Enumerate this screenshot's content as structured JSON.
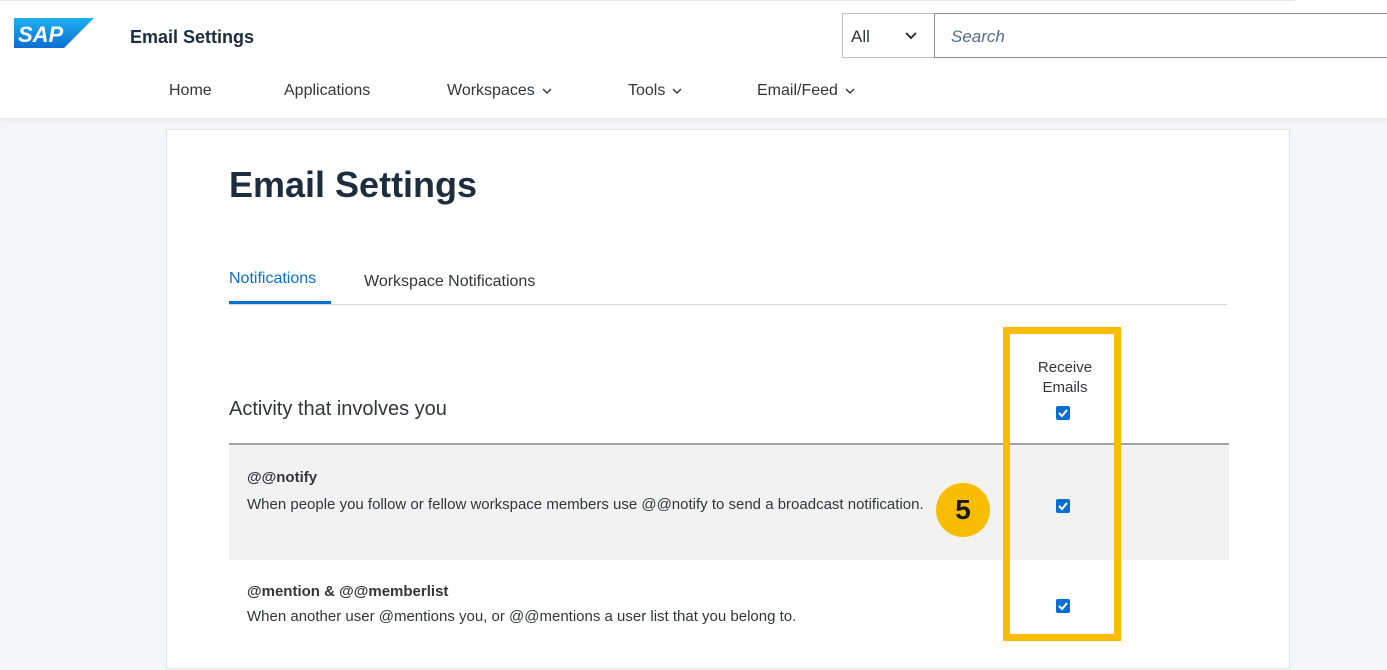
{
  "shell": {
    "logo_text": "SAP",
    "app_title": "Email Settings",
    "scope_selected": "All",
    "search_placeholder": "Search",
    "brand_color": "#0a6ed1"
  },
  "nav": {
    "items": [
      {
        "label": "Home",
        "has_dropdown": false
      },
      {
        "label": "Applications",
        "has_dropdown": false
      },
      {
        "label": "Workspaces",
        "has_dropdown": true
      },
      {
        "label": "Tools",
        "has_dropdown": true
      },
      {
        "label": "Email/Feed",
        "has_dropdown": true
      }
    ]
  },
  "page": {
    "title": "Email Settings",
    "tabs": [
      {
        "label": "Notifications",
        "active": true
      },
      {
        "label": "Workspace Notifications",
        "active": false
      }
    ],
    "section_heading": "Activity that involves you",
    "column_header": {
      "line1": "Receive",
      "line2": "Emails",
      "all_checked": true
    },
    "rows": [
      {
        "title": "@@notify",
        "description": "When people you follow or fellow workspace members use @@notify to send a broadcast notification.",
        "receive_emails": true
      },
      {
        "title": "@mention & @@memberlist",
        "description": "When another user @mentions you, or @@mentions a user list that you belong to.",
        "receive_emails": true
      }
    ]
  },
  "annotation": {
    "step_number": "5",
    "highlight_color": "#f8bd00"
  }
}
